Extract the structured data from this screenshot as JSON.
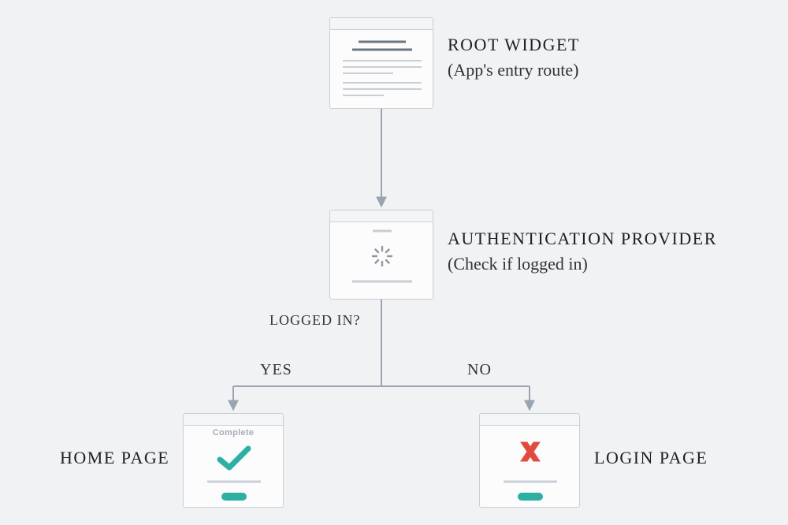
{
  "root": {
    "title": "ROOT WIDGET",
    "subtitle": "(App's entry route)"
  },
  "auth": {
    "title": "AUTHENTICATION PROVIDER",
    "subtitle": "(Check if logged in)",
    "question": "LOGGED IN?"
  },
  "branches": {
    "yes": "YES",
    "no": "NO"
  },
  "home": {
    "title": "HOME PAGE",
    "badge": "Complete"
  },
  "login": {
    "title": "LOGIN PAGE"
  },
  "colors": {
    "line": "#9aa4b1",
    "teal": "#2db0a4",
    "red": "#e04b3e",
    "innerLine": "#c9ced5"
  }
}
